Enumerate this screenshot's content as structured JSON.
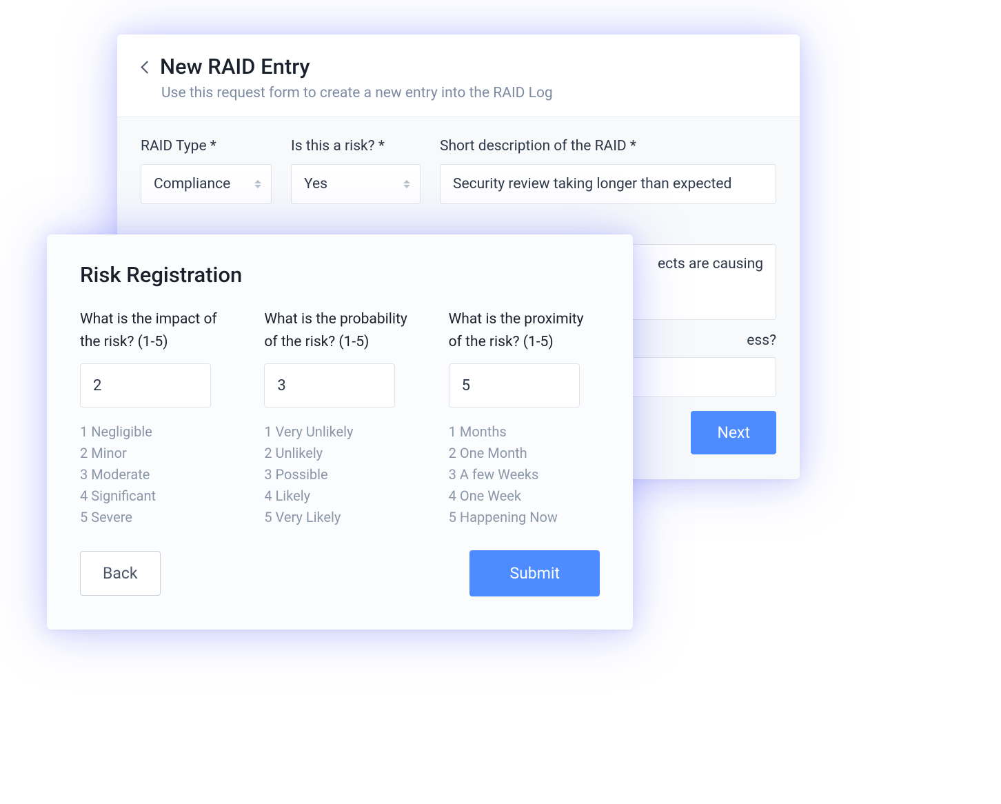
{
  "raid": {
    "title": "New RAID Entry",
    "subtitle": "Use this request form to create a new entry into the RAID Log",
    "fields": {
      "type_label": "RAID Type *",
      "type_value": "Compliance",
      "is_risk_label": "Is this a risk? *",
      "is_risk_value": "Yes",
      "short_desc_label": "Short description of the RAID *",
      "short_desc_value": "Security review taking longer than expected",
      "detail_value_partial": "ects are causing",
      "progress_label_partial": "ess?"
    },
    "next_button": "Next"
  },
  "risk": {
    "title": "Risk Registration",
    "impact": {
      "question": "What is the impact of the risk? (1-5)",
      "value": "2",
      "scale": [
        "1 Negligible",
        "2 Minor",
        "3 Moderate",
        "4 Significant",
        "5 Severe"
      ]
    },
    "probability": {
      "question": "What is the probability of the risk? (1-5)",
      "value": "3",
      "scale": [
        "1 Very Unlikely",
        "2 Unlikely",
        "3 Possible",
        "4 Likely",
        "5 Very Likely"
      ]
    },
    "proximity": {
      "question": "What is the proximity of the risk? (1-5)",
      "value": "5",
      "scale": [
        "1 Months",
        "2 One Month",
        "3 A few Weeks",
        "4 One Week",
        "5 Happening Now"
      ]
    },
    "back_button": "Back",
    "submit_button": "Submit"
  }
}
